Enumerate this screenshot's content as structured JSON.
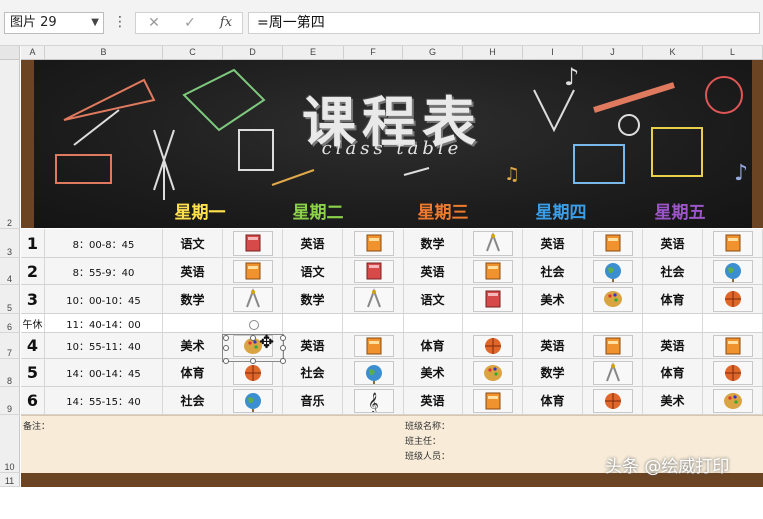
{
  "formula_bar": {
    "name_box": "图片 29",
    "formula": "=周一第四",
    "cancel_glyph": "✕",
    "enter_glyph": "✓",
    "fx_label": "fx"
  },
  "columns": [
    "A",
    "B",
    "C",
    "D",
    "E",
    "F",
    "G",
    "H",
    "I",
    "J",
    "K",
    "L"
  ],
  "rows": [
    "2",
    "3",
    "4",
    "5",
    "6",
    "7",
    "8",
    "9",
    "10",
    "11"
  ],
  "banner": {
    "title": "课程表",
    "subtitle": "class table",
    "days": [
      "星期一",
      "星期二",
      "星期三",
      "星期四",
      "星期五"
    ],
    "day_colors": [
      "#ffe14d",
      "#8bd24a",
      "#f07a2e",
      "#3a9ee8",
      "#9b55c9"
    ]
  },
  "schedule": [
    {
      "num": "1",
      "time": "8：00-8：45",
      "subjects": [
        "语文",
        "英语",
        "数学",
        "英语",
        "英语"
      ],
      "icons": [
        "book-red",
        "book-orange",
        "compass",
        "book-orange",
        "book-orange"
      ]
    },
    {
      "num": "2",
      "time": "8：55-9：40",
      "subjects": [
        "英语",
        "语文",
        "英语",
        "社会",
        "社会"
      ],
      "icons": [
        "book-orange",
        "book-red",
        "book-orange",
        "globe",
        "globe"
      ]
    },
    {
      "num": "3",
      "time": "10：00-10：45",
      "subjects": [
        "数学",
        "数学",
        "语文",
        "美术",
        "体育"
      ],
      "icons": [
        "compass",
        "compass",
        "book-red",
        "palette",
        "ball"
      ]
    },
    {
      "num": "午休",
      "time": "11：40-14：00",
      "subjects": [
        "",
        "",
        "",
        "",
        ""
      ],
      "icons": [
        "",
        "",
        "",
        "",
        ""
      ]
    },
    {
      "num": "4",
      "time": "10：55-11：40",
      "subjects": [
        "美术",
        "英语",
        "体育",
        "英语",
        "英语"
      ],
      "icons": [
        "palette",
        "book-orange",
        "ball",
        "book-orange",
        "book-orange"
      ]
    },
    {
      "num": "5",
      "time": "14：00-14：45",
      "subjects": [
        "体育",
        "社会",
        "美术",
        "数学",
        "体育"
      ],
      "icons": [
        "ball",
        "globe",
        "palette",
        "compass",
        "ball"
      ]
    },
    {
      "num": "6",
      "time": "14：55-15：40",
      "subjects": [
        "社会",
        "音乐",
        "英语",
        "体育",
        "美术"
      ],
      "icons": [
        "globe",
        "music",
        "book-orange",
        "ball",
        "palette"
      ]
    }
  ],
  "notes": {
    "remark": "备注：",
    "class_name": "班级名称：",
    "head_teacher": "班主任：",
    "members": "班级人员："
  },
  "watermark": "头条 @绘威打印"
}
